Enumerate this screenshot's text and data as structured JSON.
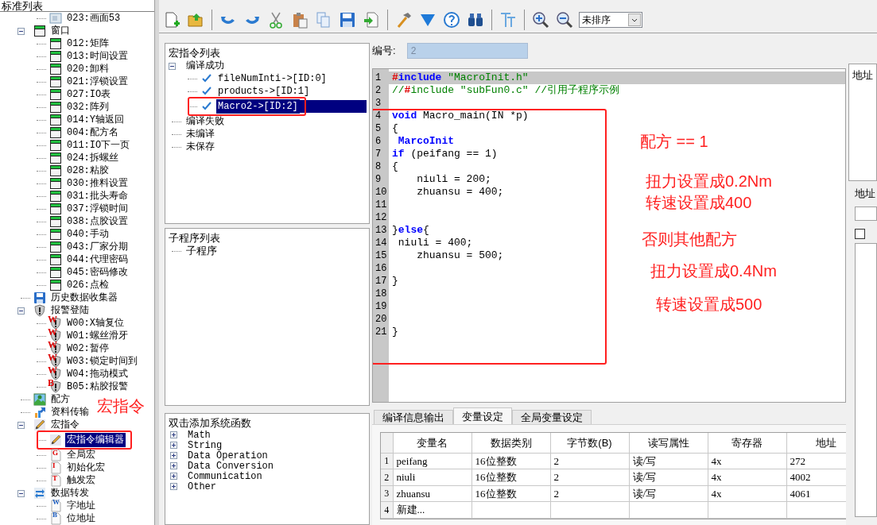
{
  "left_tree": {
    "title": "标准列表",
    "continued": [
      {
        "label": "023:画面53",
        "kind": "screen",
        "selected": false
      }
    ],
    "items": [
      {
        "label": "窗口",
        "kind": "window",
        "expanded": true,
        "selected": false,
        "children": [
          {
            "label": "012:矩阵",
            "kind": "window",
            "selected": false
          },
          {
            "label": "013:时间设置",
            "kind": "window",
            "selected": false
          },
          {
            "label": "020:卸料",
            "kind": "window",
            "selected": false
          },
          {
            "label": "021:浮锁设置",
            "kind": "window",
            "selected": false
          },
          {
            "label": "027:IO表",
            "kind": "window",
            "selected": false
          },
          {
            "label": "032:阵列",
            "kind": "window",
            "selected": false
          },
          {
            "label": "014:Y轴返回",
            "kind": "window",
            "selected": false
          },
          {
            "label": "004:配方名",
            "kind": "window",
            "selected": false
          },
          {
            "label": "011:IO下一页",
            "kind": "window",
            "selected": false
          },
          {
            "label": "024:拆螺丝",
            "kind": "window",
            "selected": false
          },
          {
            "label": "028:粘胶",
            "kind": "window",
            "selected": false
          },
          {
            "label": "030:推料设置",
            "kind": "window",
            "selected": false
          },
          {
            "label": "031:批头寿命",
            "kind": "window",
            "selected": false
          },
          {
            "label": "037:浮锁时间",
            "kind": "window",
            "selected": false
          },
          {
            "label": "038:点胶设置",
            "kind": "window",
            "selected": false
          },
          {
            "label": "040:手动",
            "kind": "window",
            "selected": false
          },
          {
            "label": "043:厂家分期",
            "kind": "window",
            "selected": false
          },
          {
            "label": "044:代理密码",
            "kind": "window",
            "selected": false
          },
          {
            "label": "045:密码修改",
            "kind": "window",
            "selected": false
          },
          {
            "label": "026:点检",
            "kind": "window",
            "selected": false
          }
        ]
      },
      {
        "label": "历史数据收集器",
        "kind": "save",
        "selected": false
      },
      {
        "label": "报警登陆",
        "kind": "shield",
        "expanded": true,
        "selected": false,
        "children": [
          {
            "label": "W00:X轴复位",
            "kind": "alarm",
            "badge": "W",
            "selected": false
          },
          {
            "label": "W01:螺丝滑牙",
            "kind": "alarm",
            "badge": "W",
            "selected": false
          },
          {
            "label": "W02:暂停",
            "kind": "alarm",
            "badge": "W",
            "selected": false
          },
          {
            "label": "W03:锁定时间到",
            "kind": "alarm",
            "badge": "W",
            "selected": false
          },
          {
            "label": "W04:拖动模式",
            "kind": "alarm",
            "badge": "W",
            "selected": false
          },
          {
            "label": "B05:粘胶报警",
            "kind": "alarm",
            "badge": "B",
            "selected": false
          }
        ]
      },
      {
        "label": "配方",
        "kind": "recipe",
        "selected": false
      },
      {
        "label": "资料传输",
        "kind": "transfer",
        "selected": false
      },
      {
        "label": "宏指令",
        "kind": "pencil",
        "expanded": true,
        "selected": false,
        "children": [
          {
            "label": "宏指令编辑器",
            "kind": "pencil",
            "selected": true
          },
          {
            "label": "全局宏",
            "kind": "macro_doc",
            "badge": "G",
            "selected": false
          },
          {
            "label": "初始化宏",
            "kind": "macro_doc",
            "badge": "I",
            "selected": false
          },
          {
            "label": "触发宏",
            "kind": "macro_doc",
            "badge": "T",
            "selected": false
          }
        ]
      },
      {
        "label": "数据转发",
        "kind": "forward",
        "expanded": true,
        "selected": false,
        "children": [
          {
            "label": "字地址",
            "kind": "address_doc",
            "badge": "W",
            "selected": false
          },
          {
            "label": "位地址",
            "kind": "address_doc",
            "badge": "B",
            "selected": false
          }
        ]
      }
    ]
  },
  "toolbar": {
    "sort_select": "未排序"
  },
  "macro_list": {
    "title": "宏指令列表",
    "items": [
      {
        "label": "编译成功",
        "expanded": true,
        "selected": false,
        "children": [
          {
            "label": "fileNumInti->[ID:0]",
            "kind": "check",
            "selected": false
          },
          {
            "label": "products->[ID:1]",
            "kind": "check",
            "selected": false
          },
          {
            "label": "Macro2->[ID:2]",
            "kind": "check",
            "selected": true
          }
        ]
      },
      {
        "label": "编译失败",
        "selected": false
      },
      {
        "label": "未编译",
        "selected": false
      },
      {
        "label": "未保存",
        "selected": false
      }
    ]
  },
  "subprogram_list": {
    "title": "子程序列表",
    "items": [
      {
        "label": "子程序",
        "selected": false
      }
    ]
  },
  "function_list": {
    "title": "双击添加系统函数",
    "items": [
      {
        "label": "Math",
        "expanded": false
      },
      {
        "label": "String",
        "expanded": false
      },
      {
        "label": "Data Operation",
        "expanded": false
      },
      {
        "label": "Data Conversion",
        "expanded": false
      },
      {
        "label": "Communication",
        "expanded": false
      },
      {
        "label": "Other",
        "expanded": false
      }
    ]
  },
  "id_field": {
    "label": "编号:",
    "value": "2"
  },
  "editor": {
    "lines": [
      {
        "number": "1",
        "current": true,
        "segments": [
          {
            "kind": "pre",
            "text": "#"
          },
          {
            "kind": "kw",
            "text": "include"
          },
          {
            "kind": "str",
            "text": " \"MacroInit.h\""
          }
        ]
      },
      {
        "number": "2",
        "current": false,
        "segments": [
          {
            "kind": "com",
            "text": "//"
          },
          {
            "kind": "pre",
            "text": "#"
          },
          {
            "kind": "com",
            "text": "include \"subFun0.c\" //引用子程序示例"
          }
        ]
      },
      {
        "number": "3",
        "current": false
      },
      {
        "number": "4",
        "current": false,
        "segments": [
          {
            "kind": "kw",
            "text": "void"
          },
          {
            "kind": "plain",
            "text": " Macro_main(IN *p)"
          }
        ]
      },
      {
        "number": "5",
        "current": false,
        "segments": [
          {
            "kind": "plain",
            "text": "{"
          }
        ]
      },
      {
        "number": "6",
        "current": false,
        "segments": [
          {
            "kind": "kw",
            "text": " MarcoInit"
          }
        ]
      },
      {
        "number": "7",
        "current": false,
        "segments": [
          {
            "kind": "kw",
            "text": "if"
          },
          {
            "kind": "plain",
            "text": " (peifang == 1)"
          }
        ]
      },
      {
        "number": "8",
        "current": false,
        "segments": [
          {
            "kind": "plain",
            "text": "{"
          }
        ]
      },
      {
        "number": "9",
        "current": false,
        "segments": [
          {
            "kind": "plain",
            "text": "    niuli = 200;"
          }
        ]
      },
      {
        "number": "10",
        "current": false,
        "segments": [
          {
            "kind": "plain",
            "text": "    zhuansu = 400;"
          }
        ]
      },
      {
        "number": "11",
        "current": false
      },
      {
        "number": "12",
        "current": false
      },
      {
        "number": "13",
        "current": false,
        "segments": [
          {
            "kind": "plain",
            "text": "}"
          },
          {
            "kind": "kw",
            "text": "else"
          },
          {
            "kind": "plain",
            "text": "{"
          }
        ]
      },
      {
        "number": "14",
        "current": false,
        "segments": [
          {
            "kind": "plain",
            "text": " niuli = 400;"
          }
        ]
      },
      {
        "number": "15",
        "current": false,
        "segments": [
          {
            "kind": "plain",
            "text": "    zhuansu = 500;"
          }
        ]
      },
      {
        "number": "16",
        "current": false
      },
      {
        "number": "17",
        "current": false,
        "segments": [
          {
            "kind": "plain",
            "text": "}"
          }
        ]
      },
      {
        "number": "18",
        "current": false
      },
      {
        "number": "19",
        "current": false
      },
      {
        "number": "20",
        "current": false
      },
      {
        "number": "21",
        "current": false,
        "segments": [
          {
            "kind": "plain",
            "text": "}"
          }
        ]
      }
    ]
  },
  "bottom_tabs": [
    {
      "label": "编译信息输出",
      "selected": false
    },
    {
      "label": "变量设定",
      "selected": true
    },
    {
      "label": "全局变量设定",
      "selected": false
    }
  ],
  "variables_table": {
    "columns": [
      "变量名",
      "数据类别",
      "字节数(B)",
      "读写属性",
      "寄存器",
      "地址"
    ],
    "rows": [
      {
        "number": "1",
        "cells": [
          "peifang",
          "16位整数",
          "2",
          "读/写",
          "4x",
          "272"
        ]
      },
      {
        "number": "2",
        "cells": [
          "niuli",
          "16位整数",
          "2",
          "读/写",
          "4x",
          "4002"
        ]
      },
      {
        "number": "3",
        "cells": [
          "zhuansu",
          "16位整数",
          "2",
          "读/写",
          "4x",
          "4061"
        ]
      },
      {
        "number": "4",
        "cells": [
          "新建..."
        ]
      }
    ]
  },
  "right_panel": {
    "title": "地址",
    "group_label": "地址",
    "checkbox_checked": false
  },
  "annotations": [
    "宏指令",
    "配方 == 1",
    "扭力设置成0.2Nm",
    "转速设置成400",
    "否则其他配方",
    "扭力设置成0.4Nm",
    "转速设置成500"
  ]
}
